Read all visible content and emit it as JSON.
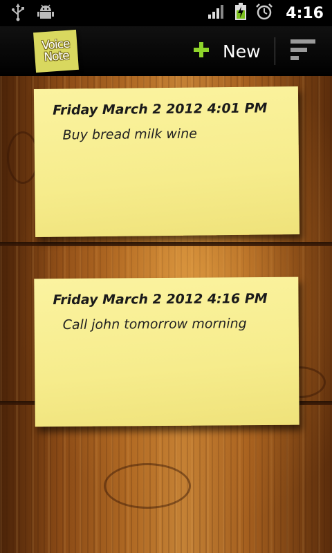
{
  "status_bar": {
    "icons": [
      "usb-icon",
      "android-debug-icon",
      "signal-icon",
      "battery-charging-icon",
      "alarm-icon"
    ],
    "time": "4:16"
  },
  "action_bar": {
    "logo_line1": "Voice",
    "logo_line2": "Note",
    "new_label": "New",
    "accent_color": "#8ed42b",
    "icons": [
      "plus-icon",
      "sort-icon"
    ]
  },
  "notes": [
    {
      "date": "Friday March 2 2012 4:01 PM",
      "text": "Buy bread milk wine"
    },
    {
      "date": "Friday March 2 2012 4:16 PM",
      "text": "Call john tomorrow morning"
    }
  ],
  "colors": {
    "note_yellow": "#f7ee93",
    "wood": "#b06a24"
  }
}
